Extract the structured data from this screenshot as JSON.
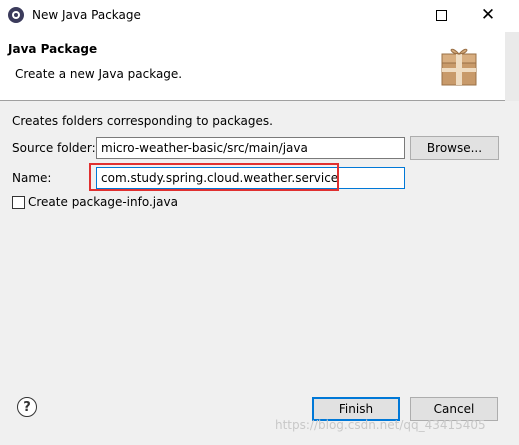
{
  "window": {
    "title": "New Java Package",
    "max_icon": "maximize-icon",
    "close_icon": "close-icon"
  },
  "banner": {
    "title": "Java Package",
    "description": "Create a new Java package.",
    "icon": "package-icon"
  },
  "form": {
    "intro": "Creates folders corresponding to packages.",
    "source_folder_label": "Source folder:",
    "source_folder_value": "micro-weather-basic/src/main/java",
    "browse_label": "Browse...",
    "name_label": "Name:",
    "name_value": "com.study.spring.cloud.weather.service",
    "create_info_label": "Create package-info.java",
    "create_info_checked": false
  },
  "footer": {
    "help_icon": "help-icon",
    "finish_label": "Finish",
    "cancel_label": "Cancel",
    "watermark": "https://blog.csdn.net/qq_43415405"
  },
  "colors": {
    "highlight": "#e03030",
    "focus": "#0078d7"
  }
}
